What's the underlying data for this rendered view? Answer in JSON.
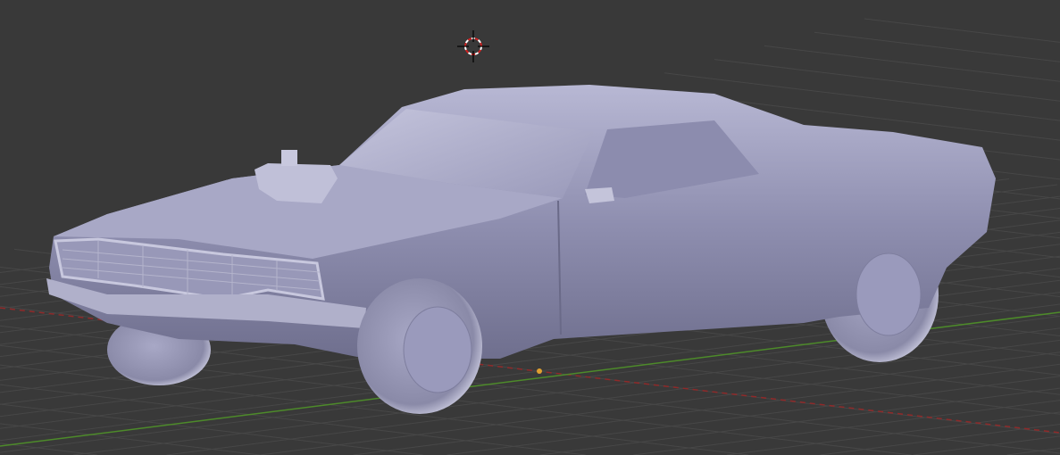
{
  "viewport": {
    "background_color": "#393939",
    "grid_color": "#4a4a4a",
    "x_axis_color": "#8f2a2a",
    "y_axis_color": "#4d8a2a",
    "model_color": "#a3a3c2",
    "cursor_icon": "3d-cursor-icon",
    "origin_icon": "object-origin-icon",
    "origin_color": "#e0a030"
  }
}
